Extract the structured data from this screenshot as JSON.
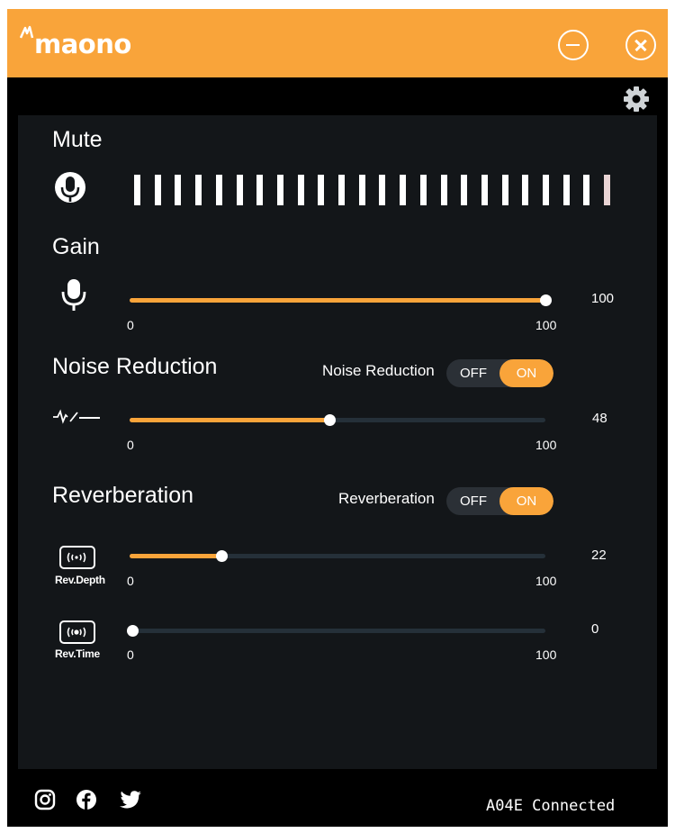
{
  "app": {
    "brand": "maono"
  },
  "titlebar": {
    "minimize_icon": "minimize-circle-icon",
    "close_icon": "close-circle-icon"
  },
  "settings_icon": "gear-icon",
  "mute": {
    "title": "Mute",
    "icon": "microphone-circle-icon",
    "meter_segments": 24
  },
  "gain": {
    "title": "Gain",
    "icon": "microphone-icon",
    "min": "0",
    "max": "100",
    "value": "100",
    "fraction": 1.0
  },
  "noise_reduction": {
    "title": "Noise Reduction",
    "icon": "noise-wave-icon",
    "toggle_label": "Noise Reduction",
    "off_label": "OFF",
    "on_label": "ON",
    "state": "ON",
    "min": "0",
    "max": "100",
    "value": "48",
    "fraction": 0.48
  },
  "reverberation": {
    "title": "Reverberation",
    "toggle_label": "Reverberation",
    "off_label": "OFF",
    "on_label": "ON",
    "state": "ON",
    "depth": {
      "label": "Rev.Depth",
      "icon": "reverb-depth-icon",
      "min": "0",
      "max": "100",
      "value": "22",
      "fraction": 0.22
    },
    "time": {
      "label": "Rev.Time",
      "icon": "reverb-time-icon",
      "min": "0",
      "max": "100",
      "value": "0",
      "fraction": 0.0
    }
  },
  "footer": {
    "social_icons": [
      "instagram-icon",
      "facebook-icon",
      "twitter-icon"
    ],
    "status": "A04E Connected"
  },
  "colors": {
    "accent": "#f9a43a",
    "titlebar": "#f9a43a",
    "panel": "#131619",
    "track": "#253039"
  }
}
